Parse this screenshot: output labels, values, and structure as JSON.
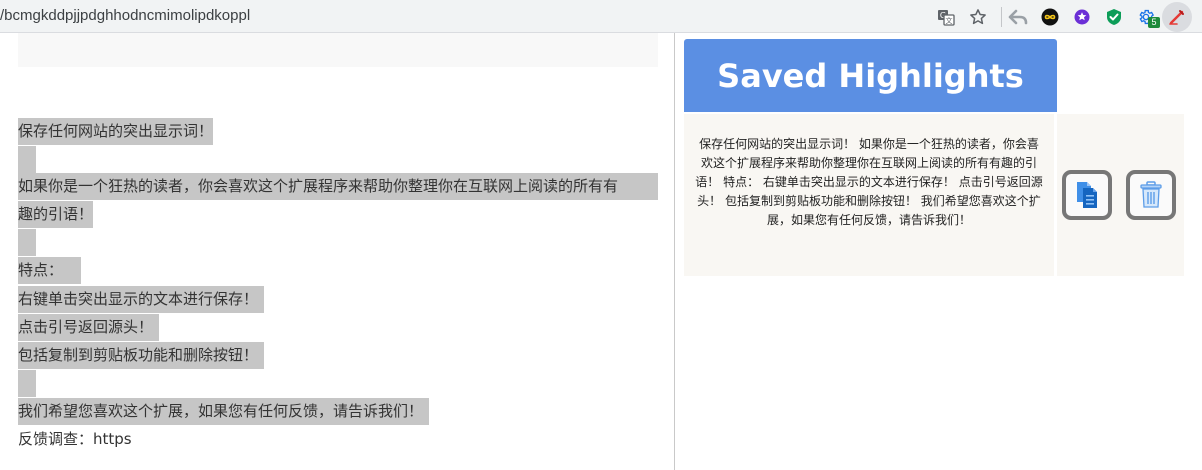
{
  "browser": {
    "url": "/bcmgkddpjjpdghhodncmimolipdkoppl",
    "extension_badge": "5"
  },
  "page": {
    "highlight_lines": [
      "保存任何网站的突出显示词！",
      "如果你是一个狂热的读者，你会喜欢这个扩展程序来帮助你整理你在互联网上阅读的所有有",
      "趣的引语！",
      "特点：",
      "右键单击突出显示的文本进行保存！",
      "点击引号返回源头！",
      "包括复制到剪贴板功能和删除按钮！",
      "我们希望您喜欢这个扩展，如果您有任何反馈，请告诉我们！"
    ],
    "feedback_line": "反馈调查：https"
  },
  "popup": {
    "title": "Saved Highlights",
    "highlights": [
      {
        "text": "保存任何网站的突出显示词！ 如果你是一个狂热的读者，你会喜欢这个扩展程序来帮助你整理你在互联网上阅读的所有有趣的引语！ 特点： 右键单击突出显示的文本进行保存！ 点击引号返回源头！ 包括复制到剪贴板功能和删除按钮！ 我们希望您喜欢这个扩展，如果您有任何反馈，请告诉我们！"
      }
    ]
  },
  "colors": {
    "header_blue": "#5b8fe3",
    "highlight_gray": "#c6c6c6",
    "button_border": "#777777"
  },
  "icons": [
    "translate-icon",
    "star-icon",
    "back-arrow-icon",
    "infinity-icon",
    "purple-star-icon",
    "shield-check-icon",
    "gear-icon",
    "highlighter-icon",
    "copy-icon",
    "trash-icon"
  ]
}
